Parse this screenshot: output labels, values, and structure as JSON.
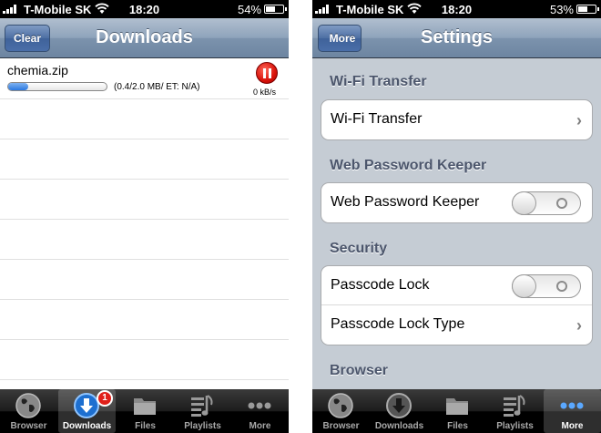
{
  "left": {
    "status": {
      "carrier": "T-Mobile SK",
      "time": "18:20",
      "battery": "54%",
      "battery_level": 0.54
    },
    "nav": {
      "title": "Downloads",
      "clear_label": "Clear"
    },
    "download": {
      "name": "chemia.zip",
      "progress": 0.2,
      "info": "(0.4/2.0 MB/ ET: N/A)",
      "speed": "0 kB/s"
    },
    "tabs": [
      {
        "label": "Browser",
        "icon": "globe-icon"
      },
      {
        "label": "Downloads",
        "icon": "download-arrow-icon",
        "badge": "1",
        "selected": true
      },
      {
        "label": "Files",
        "icon": "folder-icon"
      },
      {
        "label": "Playlists",
        "icon": "playlist-icon"
      },
      {
        "label": "More",
        "icon": "more-dots-icon"
      }
    ]
  },
  "right": {
    "status": {
      "carrier": "T-Mobile SK",
      "time": "18:20",
      "battery": "53%",
      "battery_level": 0.53
    },
    "nav": {
      "title": "Settings",
      "back_label": "More"
    },
    "sections": [
      {
        "header": "Wi-Fi Transfer",
        "rows": [
          {
            "label": "Wi-Fi Transfer",
            "accessory": "chevron"
          }
        ]
      },
      {
        "header": "Web Password Keeper",
        "rows": [
          {
            "label": "Web Password Keeper",
            "accessory": "toggle",
            "value": "off"
          }
        ]
      },
      {
        "header": "Security",
        "rows": [
          {
            "label": "Passcode Lock",
            "accessory": "toggle",
            "value": "off"
          },
          {
            "label": "Passcode Lock Type",
            "accessory": "chevron"
          }
        ]
      },
      {
        "header": "Browser",
        "rows": []
      }
    ],
    "tabs": [
      {
        "label": "Browser",
        "icon": "globe-icon"
      },
      {
        "label": "Downloads",
        "icon": "download-arrow-icon"
      },
      {
        "label": "Files",
        "icon": "folder-icon"
      },
      {
        "label": "Playlists",
        "icon": "playlist-icon"
      },
      {
        "label": "More",
        "icon": "more-dots-icon",
        "selected": true
      }
    ]
  },
  "colors": {
    "tab_selected_icon": "#3a8ee8",
    "more_selected_dots": "#5aa8ff",
    "section_header": "#4c566c",
    "settings_bg": "#c5ccd4"
  }
}
